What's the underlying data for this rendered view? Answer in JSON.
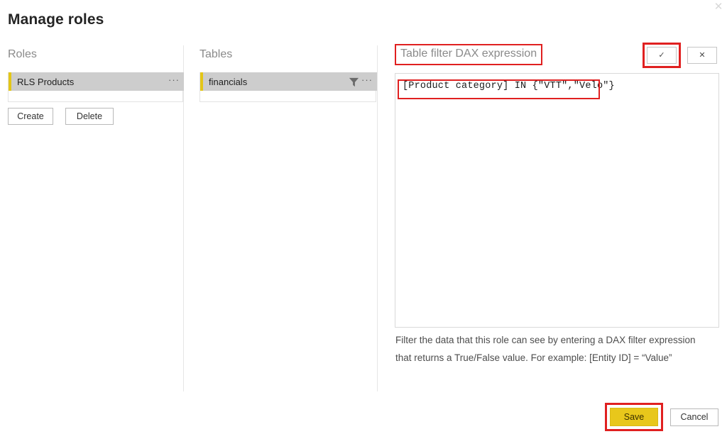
{
  "window": {
    "close_glyph": "✕",
    "title": "Manage roles"
  },
  "colors": {
    "annotation": "#e02020",
    "accent_yellow": "#e3c618",
    "save_button": "#e8c71b",
    "list_selected": "#cdcdcd"
  },
  "roles_panel": {
    "heading": "Roles",
    "items": [
      {
        "label": "RLS Products",
        "menu_glyph": "···"
      }
    ],
    "create_label": "Create",
    "delete_label": "Delete"
  },
  "tables_panel": {
    "heading": "Tables",
    "items": [
      {
        "label": "financials",
        "icon": "filter-icon",
        "menu_glyph": "···"
      }
    ]
  },
  "dax_panel": {
    "heading": "Table filter DAX expression",
    "accept_glyph": "✓",
    "reject_glyph": "✕",
    "expression": "[Product category] IN {\"VTT\",\"Velo\"}",
    "help_line_1": "Filter the data that this role can see by entering a DAX filter expression",
    "help_line_2": "that returns a True/False value. For example: [Entity ID] = “Value”"
  },
  "footer": {
    "save_label": "Save",
    "cancel_label": "Cancel"
  }
}
